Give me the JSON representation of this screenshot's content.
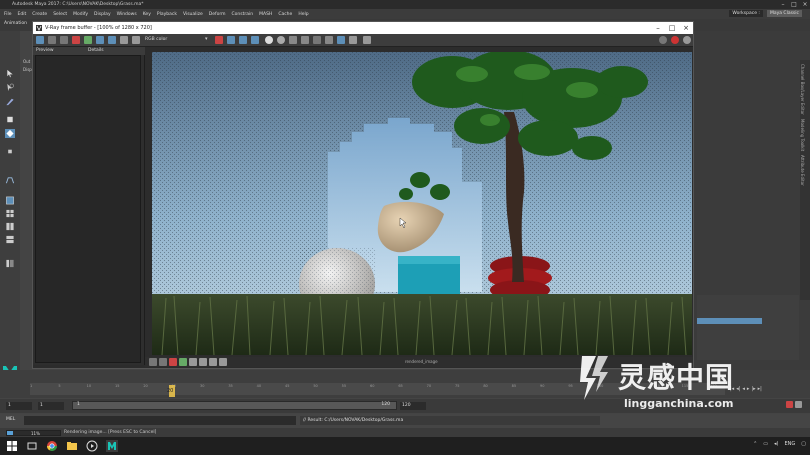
{
  "maya": {
    "title": "Autodesk Maya 2017: C:\\Users\\NOVAK\\Desktop\\Grass.ma*",
    "menus": [
      "File",
      "Edit",
      "Create",
      "Select",
      "Modify",
      "Display",
      "Windows",
      "Key",
      "Playback",
      "Visualize",
      "Deform",
      "Constrain",
      "MASH",
      "Cache",
      "Help"
    ],
    "workspace_label": "Workspace :",
    "workspace_value": "Maya Classic",
    "shelf_label": "Animation",
    "left_panel_labels": [
      "Out",
      "Disp"
    ],
    "right_vtabs": [
      "Channel Box/Layer Editor",
      "Modeling Toolkit",
      "Attribute Editor"
    ]
  },
  "vfb": {
    "title": "V-Ray frame buffer - [100% of 1280 x 720]",
    "channel": "RGB color",
    "history_columns": [
      "Preview",
      "Details"
    ],
    "bottom_label": "rendered_image"
  },
  "timeline": {
    "current_frame": "20",
    "ticks": [
      "1",
      "5",
      "10",
      "15",
      "20",
      "25",
      "30",
      "35",
      "40",
      "45",
      "50",
      "55",
      "60",
      "65",
      "70",
      "75",
      "80",
      "85",
      "90",
      "95",
      "100",
      "105",
      "110",
      "115",
      "120"
    ],
    "range_start": "1",
    "range_inner_start": "1",
    "range_inner_end": "120",
    "range_end": "120"
  },
  "command_line": {
    "language": "MEL",
    "result": "// Result: C:/Users/NOVAK/Desktop/Grass.ma"
  },
  "status": {
    "progress_text": "11%",
    "progress_value": 0.11,
    "message": "Rendering image... [Press ESC to Cancel]"
  },
  "taskbar": {
    "lang": "ENG"
  },
  "watermark": {
    "cn": "灵感中国",
    "en": "lingganchina.com"
  },
  "colors": {
    "accent_blue": "#5d8fb8",
    "time_indicator": "#f2c94c",
    "maya_logo": "#19c4b6"
  }
}
